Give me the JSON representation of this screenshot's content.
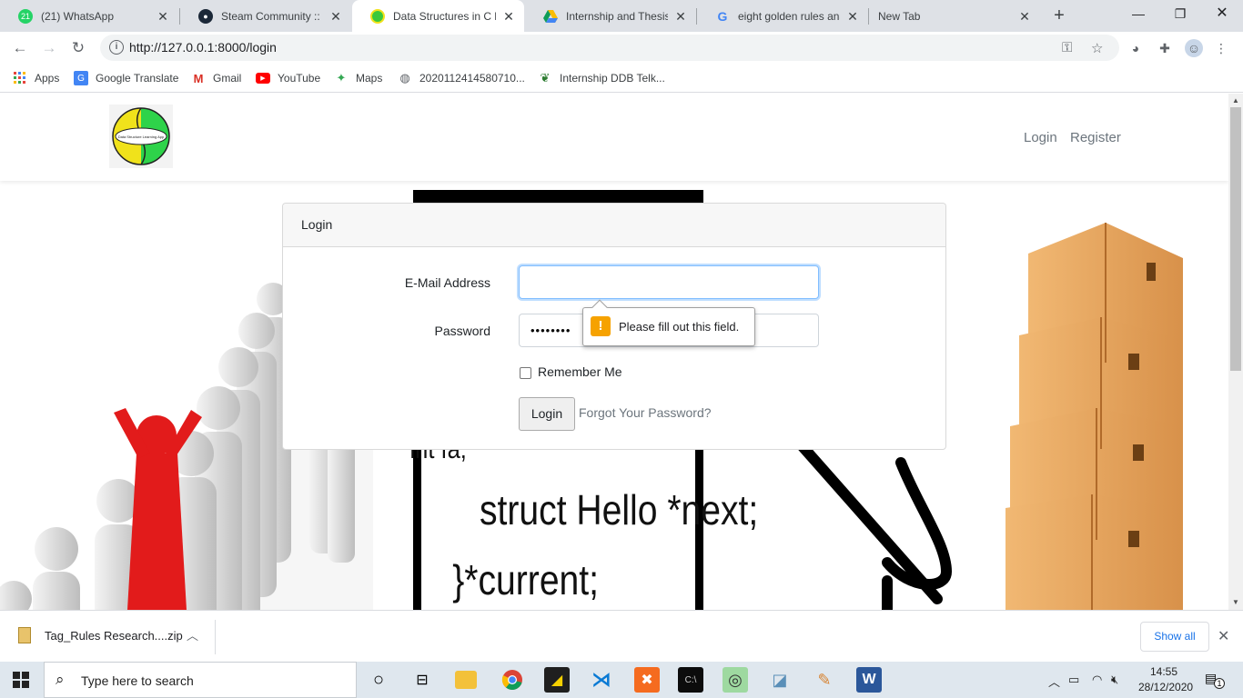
{
  "browser": {
    "tabs": [
      {
        "title": "(21) WhatsApp",
        "badge": "21"
      },
      {
        "title": "Steam Community :: Gu"
      },
      {
        "title": "Data Structures in C lan"
      },
      {
        "title": "Internship and Thesis B"
      },
      {
        "title": "eight golden rules anal"
      },
      {
        "title": "New Tab"
      }
    ],
    "url": "http://127.0.0.1:8000/login",
    "bookmarks": [
      {
        "label": "Apps"
      },
      {
        "label": "Google Translate"
      },
      {
        "label": "Gmail"
      },
      {
        "label": "YouTube"
      },
      {
        "label": "Maps"
      },
      {
        "label": "2020112414580710..."
      },
      {
        "label": "Internship DDB Telk..."
      }
    ]
  },
  "site": {
    "nav": {
      "login": "Login",
      "register": "Register"
    },
    "logo_text": "Data Structure Learning App"
  },
  "background": {
    "code_line_1": "int fa;",
    "code_line_2": "struct Hello *next;",
    "code_line_3": "}*current;"
  },
  "login_form": {
    "header": "Login",
    "email_label": "E-Mail Address",
    "email_value": "",
    "password_label": "Password",
    "password_value": "••••••••",
    "remember_label": "Remember Me",
    "remember_checked": false,
    "submit_label": "Login",
    "forgot_label": "Forgot Your Password?"
  },
  "validation_tooltip": {
    "message": "Please fill out this field.",
    "icon": "!"
  },
  "downloads": {
    "file_name": "Tag_Rules Research....zip",
    "show_all": "Show all"
  },
  "taskbar": {
    "search_placeholder": "Type here to search",
    "time": "14:55",
    "date": "28/12/2020",
    "notification_count": "1"
  },
  "colors": {
    "tab_strip": "#dee1e6",
    "accent_blue": "#1a73e8",
    "focus_border": "#80bdff",
    "warning": "#f6a200"
  }
}
